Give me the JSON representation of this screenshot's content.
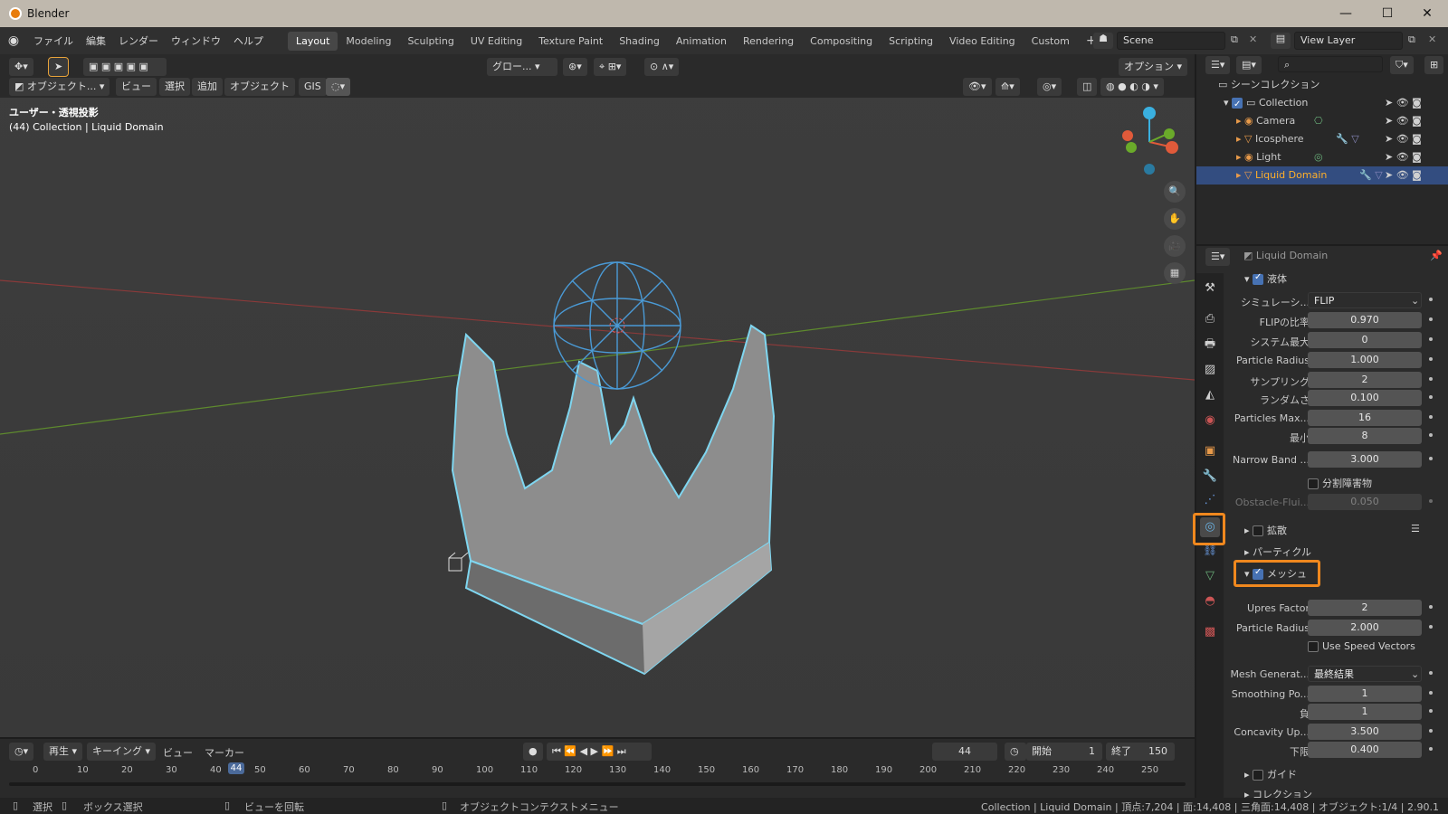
{
  "window": {
    "title": "Blender",
    "min": "—",
    "max": "☐",
    "close": "✕"
  },
  "menu": [
    "ファイル",
    "編集",
    "レンダー",
    "ウィンドウ",
    "ヘルプ"
  ],
  "workspaces": [
    "Layout",
    "Modeling",
    "Sculpting",
    "UV Editing",
    "Texture Paint",
    "Shading",
    "Animation",
    "Rendering",
    "Compositing",
    "Scripting",
    "Video Editing",
    "Custom"
  ],
  "add_ws": "+",
  "scene": "Scene",
  "view_layer": "View Layer",
  "toolbar": {
    "transform": "グロー...",
    "options": "オプション"
  },
  "viewport": {
    "mode": "オブジェクト...",
    "menus": [
      "ビュー",
      "選択",
      "追加",
      "オブジェクト",
      "GIS"
    ],
    "view_name": "ユーザー・透視投影",
    "collection_info": "(44) Collection | Liquid Domain"
  },
  "outliner": {
    "header": "シーンコレクション",
    "items": [
      "Collection",
      "Camera",
      "Icosphere",
      "Light",
      "Liquid Domain"
    ]
  },
  "properties": {
    "object_name": "Liquid Domain",
    "liquid_label": "液体",
    "rows": [
      {
        "label": "シミュレーシ...",
        "value": "FLIP"
      },
      {
        "label": "FLIPの比率",
        "value": "0.970"
      },
      {
        "label": "システム最大",
        "value": "0"
      },
      {
        "label": "Particle Radius",
        "value": "1.000"
      },
      {
        "label": "サンプリング",
        "value": "2"
      },
      {
        "label": "ランダムさ",
        "value": "0.100"
      },
      {
        "label": "Particles Max...",
        "value": "16"
      },
      {
        "label": "最小",
        "value": "8"
      },
      {
        "label": "Narrow Band ...",
        "value": "3.000"
      }
    ],
    "fractional_obstacles": "分割障害物",
    "obstacle_label": "Obstacle-Flui...",
    "obstacle_value": "0.050",
    "diffusion": "拡散",
    "particles": "パーティクル",
    "mesh": "メッシュ",
    "mesh_rows": [
      {
        "label": "Upres Factor",
        "value": "2"
      },
      {
        "label": "Particle Radius",
        "value": "2.000"
      }
    ],
    "use_speed_vectors": "Use Speed Vectors",
    "mesh_rows2": [
      {
        "label": "Mesh Generat...",
        "value": "最終結果"
      },
      {
        "label": "Smoothing Po...",
        "value": "1"
      },
      {
        "label": "負",
        "value": "1"
      },
      {
        "label": "Concavity Up...",
        "value": "3.500"
      },
      {
        "label": "下限",
        "value": "0.400"
      }
    ],
    "guide": "ガイド",
    "collection": "コレクション"
  },
  "timeline": {
    "menus": [
      "再生",
      "キーイング",
      "ビュー",
      "マーカー"
    ],
    "current_frame": "44",
    "start_label": "開始",
    "start": "1",
    "end_label": "終了",
    "end": "150",
    "ticks": [
      "0",
      "10",
      "20",
      "30",
      "40",
      "44",
      "50",
      "60",
      "70",
      "80",
      "90",
      "100",
      "110",
      "120",
      "130",
      "140",
      "150",
      "160",
      "170",
      "180",
      "190",
      "200",
      "210",
      "220",
      "230",
      "240",
      "250"
    ]
  },
  "status": {
    "select": "選択",
    "box_select": "ボックス選択",
    "rotate": "ビューを回転",
    "context": "オブジェクトコンテクストメニュー",
    "stats": "Collection | Liquid Domain | 頂点:7,204 | 面:14,408 | 三角面:14,408 | オブジェクト:1/4 | 2.90.1"
  },
  "colors": {
    "accent": "#4772b3",
    "highlight": "#f0881e",
    "selected_row": "#334d80"
  }
}
